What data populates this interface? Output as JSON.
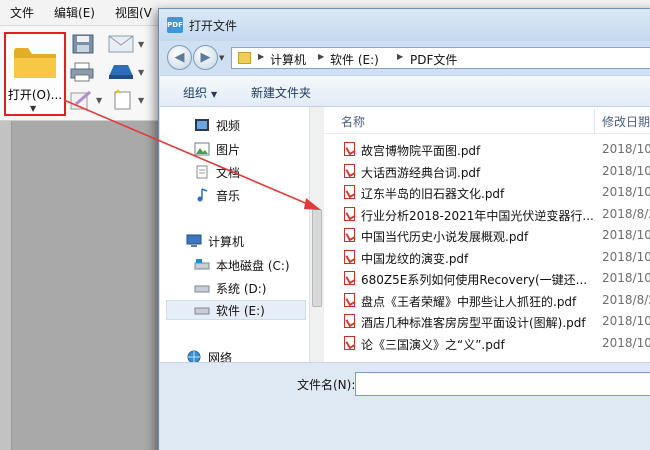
{
  "app": {
    "menu": [
      "文件",
      "编辑(E)",
      "视图(V"
    ],
    "open_button_label": "打开(O)..."
  },
  "dialog": {
    "title": "打开文件",
    "breadcrumb": [
      "计算机",
      "软件 (E:)",
      "PDF文件"
    ],
    "commands": {
      "organize": "组织",
      "new_folder": "新建文件夹"
    },
    "nav_items": [
      {
        "label": "视频",
        "icon": "video-icon"
      },
      {
        "label": "图片",
        "icon": "picture-icon"
      },
      {
        "label": "文档",
        "icon": "document-icon"
      },
      {
        "label": "音乐",
        "icon": "music-icon"
      },
      {
        "label": "计算机",
        "icon": "computer-icon"
      },
      {
        "label": "本地磁盘 (C:)",
        "icon": "drive-icon"
      },
      {
        "label": "系统 (D:)",
        "icon": "drive-icon"
      },
      {
        "label": "软件 (E:)",
        "icon": "drive-icon"
      },
      {
        "label": "网络",
        "icon": "network-icon"
      }
    ],
    "columns": {
      "name": "名称",
      "modified": "修改日期"
    },
    "files": [
      {
        "name": "故宫博物院平面图.pdf",
        "date": "2018/10"
      },
      {
        "name": "大话西游经典台词.pdf",
        "date": "2018/10"
      },
      {
        "name": "辽东半岛的旧石器文化.pdf",
        "date": "2018/10"
      },
      {
        "name": "行业分析2018-2021年中国光伏逆变器行...",
        "date": "2018/8/2"
      },
      {
        "name": "中国当代历史小说发展概观.pdf",
        "date": "2018/10"
      },
      {
        "name": "中国龙纹的演变.pdf",
        "date": "2018/10"
      },
      {
        "name": "680Z5E系列如何使用Recovery(一键还...",
        "date": "2018/10"
      },
      {
        "name": "盘点《王者荣耀》中那些让人抓狂的.pdf",
        "date": "2018/8/2"
      },
      {
        "name": "酒店几种标准客房房型平面设计(图解).pdf",
        "date": "2018/10"
      },
      {
        "name": "论《三国演义》之“义”.pdf",
        "date": "2018/10"
      }
    ],
    "filename_label": "文件名(N):",
    "filename_value": ""
  },
  "colors": {
    "highlight": "#e02020",
    "arrow": "#e03a3a"
  }
}
